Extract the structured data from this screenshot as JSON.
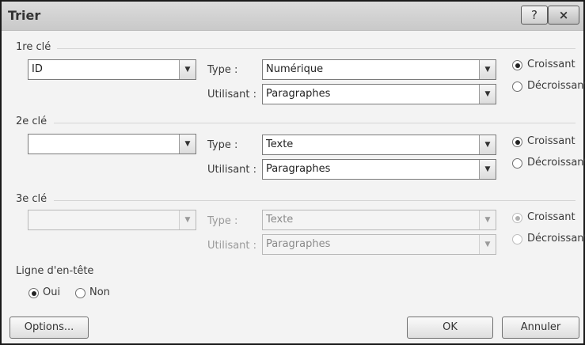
{
  "window": {
    "title": "Trier",
    "help": "?",
    "close": "×"
  },
  "key1": {
    "group_label": "1re clé",
    "field": "ID",
    "type_label": "Type :",
    "type_value": "Numérique",
    "using_label": "Utilisant :",
    "using_value": "Paragraphes",
    "ascending": "Croissant",
    "descending": "Décroissant",
    "order": "Croissant"
  },
  "key2": {
    "group_label": "2e clé",
    "field": "",
    "type_label": "Type :",
    "type_value": "Texte",
    "using_label": "Utilisant :",
    "using_value": "Paragraphes",
    "ascending": "Croissant",
    "descending": "Décroissant",
    "order": "Croissant"
  },
  "key3": {
    "group_label": "3e clé",
    "field": "",
    "type_label": "Type :",
    "type_value": "Texte",
    "using_label": "Utilisant :",
    "using_value": "Paragraphes",
    "ascending": "Croissant",
    "descending": "Décroissant",
    "order": "Croissant",
    "enabled": false
  },
  "header_row": {
    "label": "Ligne d'en-tête",
    "yes": "Oui",
    "no": "Non",
    "selected": "Oui"
  },
  "buttons": {
    "options": "Options...",
    "ok": "OK",
    "cancel": "Annuler"
  },
  "colors": {
    "titlebar": "#cfcfcf",
    "dialog_bg": "#f3f3f3",
    "border": "#1a1a1a"
  }
}
